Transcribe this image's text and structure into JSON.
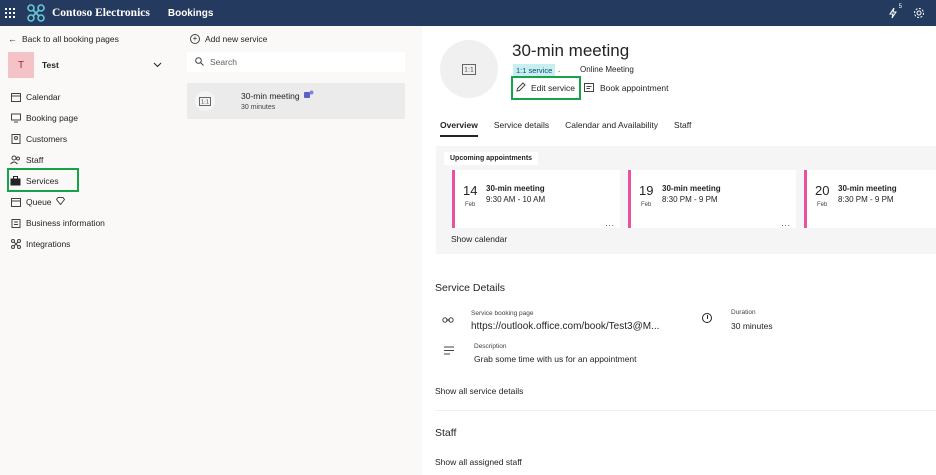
{
  "topbar": {
    "brand": "Contoso Electronics",
    "app_name": "Bookings",
    "notification_count": "5",
    "colors": {
      "bar": "#243a5e",
      "logo": "#69c7d8"
    }
  },
  "leftnav": {
    "back_label": "Back to all booking pages",
    "page": {
      "initial": "T",
      "name": "Test"
    },
    "items": [
      {
        "label": "Calendar",
        "icon": "calendar-icon"
      },
      {
        "label": "Booking page",
        "icon": "monitor-icon"
      },
      {
        "label": "Customers",
        "icon": "contact-card-icon"
      },
      {
        "label": "Staff",
        "icon": "people-icon"
      },
      {
        "label": "Services",
        "icon": "briefcase-icon"
      },
      {
        "label": "Queue",
        "icon": "queue-icon"
      },
      {
        "label": "Business information",
        "icon": "building-icon"
      },
      {
        "label": "Integrations",
        "icon": "integrations-icon"
      }
    ],
    "highlight_color": "#16a34a"
  },
  "midpane": {
    "add_service_label": "Add new service",
    "search_placeholder": "Search",
    "service": {
      "badge": "1:1",
      "title": "30-min meeting",
      "duration": "30 minutes"
    }
  },
  "detail": {
    "badge": "1:1",
    "title": "30-min meeting",
    "tag": "1:1 service",
    "separator": ".",
    "meeting_type": "Online Meeting",
    "edit_label": "Edit service",
    "book_label": "Book appointment",
    "tabs": [
      "Overview",
      "Service details",
      "Calendar and Availability",
      "Staff"
    ],
    "upcoming_label": "Upcoming appointments",
    "appointments": [
      {
        "day": "14",
        "month": "Feb",
        "title": "30-min meeting",
        "time": "9:30 AM - 10 AM"
      },
      {
        "day": "19",
        "month": "Feb",
        "title": "30-min meeting",
        "time": "8:30 PM - 9 PM"
      },
      {
        "day": "20",
        "month": "Feb",
        "title": "30-min meeting",
        "time": "8:30 PM - 9 PM"
      }
    ],
    "more_glyph": "...",
    "show_calendar_label": "Show calendar",
    "service_details_heading": "Service Details",
    "booking_page_label": "Service booking page",
    "booking_page_url": "https://outlook.office.com/book/Test3@M...",
    "duration_label": "Duration",
    "duration_value": "30 minutes",
    "description_label": "Description",
    "description_value": "Grab some time with us for an appointment",
    "show_all_details_label": "Show all service details",
    "staff_heading": "Staff",
    "show_all_staff_label": "Show all assigned staff",
    "appointment_accent": "#e8529f",
    "tag_bg": "#c7eef0"
  }
}
